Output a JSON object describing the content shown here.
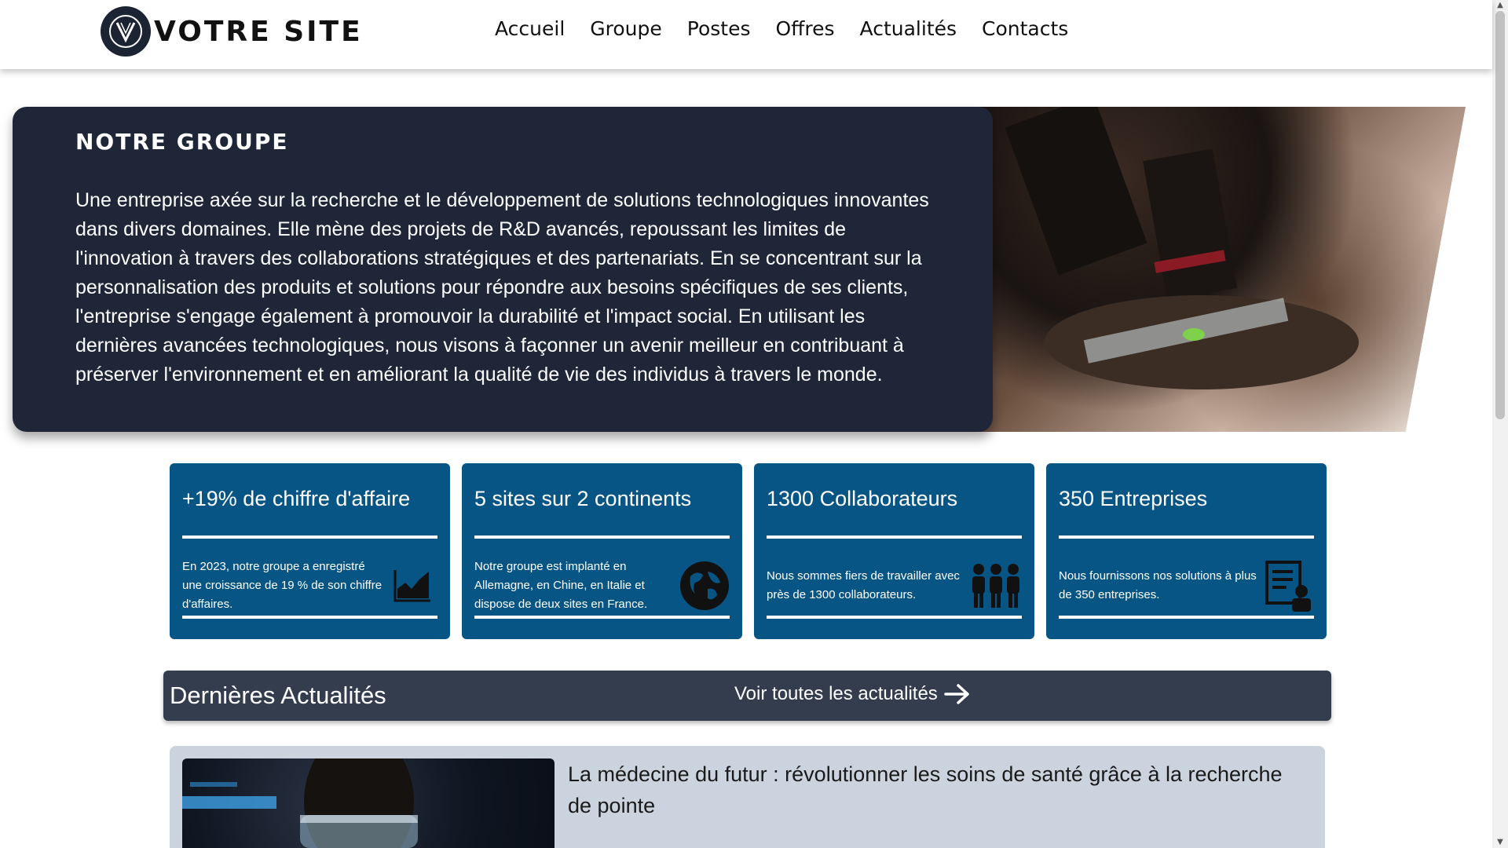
{
  "header": {
    "logo_text": "VOTRE SITE",
    "nav": [
      "Accueil",
      "Groupe",
      "Postes",
      "Offres",
      "Actualités",
      "Contacts"
    ]
  },
  "hero": {
    "title": "NOTRE GROUPE",
    "text": "Une entreprise axée sur la recherche et le développement de solutions technologiques innovantes dans divers domaines. Elle mène des projets de R&D avancés, repoussant les limites de l'innovation à travers des collaborations stratégiques et des partenariats. En se concentrant sur la personnalisation des produits et solutions pour répondre aux besoins spécifiques de ses clients, l'entreprise s'engage également à promouvoir la durabilité et l'impact social. En utilisant les dernières avancées technologiques, nous visons à façonner un avenir meilleur en contribuant à préserver l'environnement et en améliorant la qualité de vie des individus à travers le monde."
  },
  "stats": [
    {
      "title": "+19% de chiffre d'affaire",
      "text": "En 2023, notre groupe a enregistré une croissance de 19 % de son chiffre d'affaires.",
      "icon": "chart-icon"
    },
    {
      "title": "5 sites sur 2 continents",
      "text": "Notre groupe est implanté en Allemagne, en Chine, en Italie et dispose de deux sites en France.",
      "icon": "globe-icon"
    },
    {
      "title": "1300 Collaborateurs",
      "text": "Nous sommes fiers de travailler avec près de 1300 collaborateurs.",
      "icon": "people-icon"
    },
    {
      "title": "350 Entreprises",
      "text": "Nous fournissons nos solutions à plus de 350 entreprises.",
      "icon": "client-document-icon"
    }
  ],
  "news": {
    "title": "Dernières Actualités",
    "link": "Voir toutes les actualités",
    "article_title": "La médecine du futur : révolutionner les soins de santé grâce à la recherche de pointe"
  },
  "colors": {
    "hero_bg": "#1e2638",
    "card_bg": "#075585",
    "news_bar_bg": "#333d4e",
    "article_bg": "#cbd3de"
  }
}
